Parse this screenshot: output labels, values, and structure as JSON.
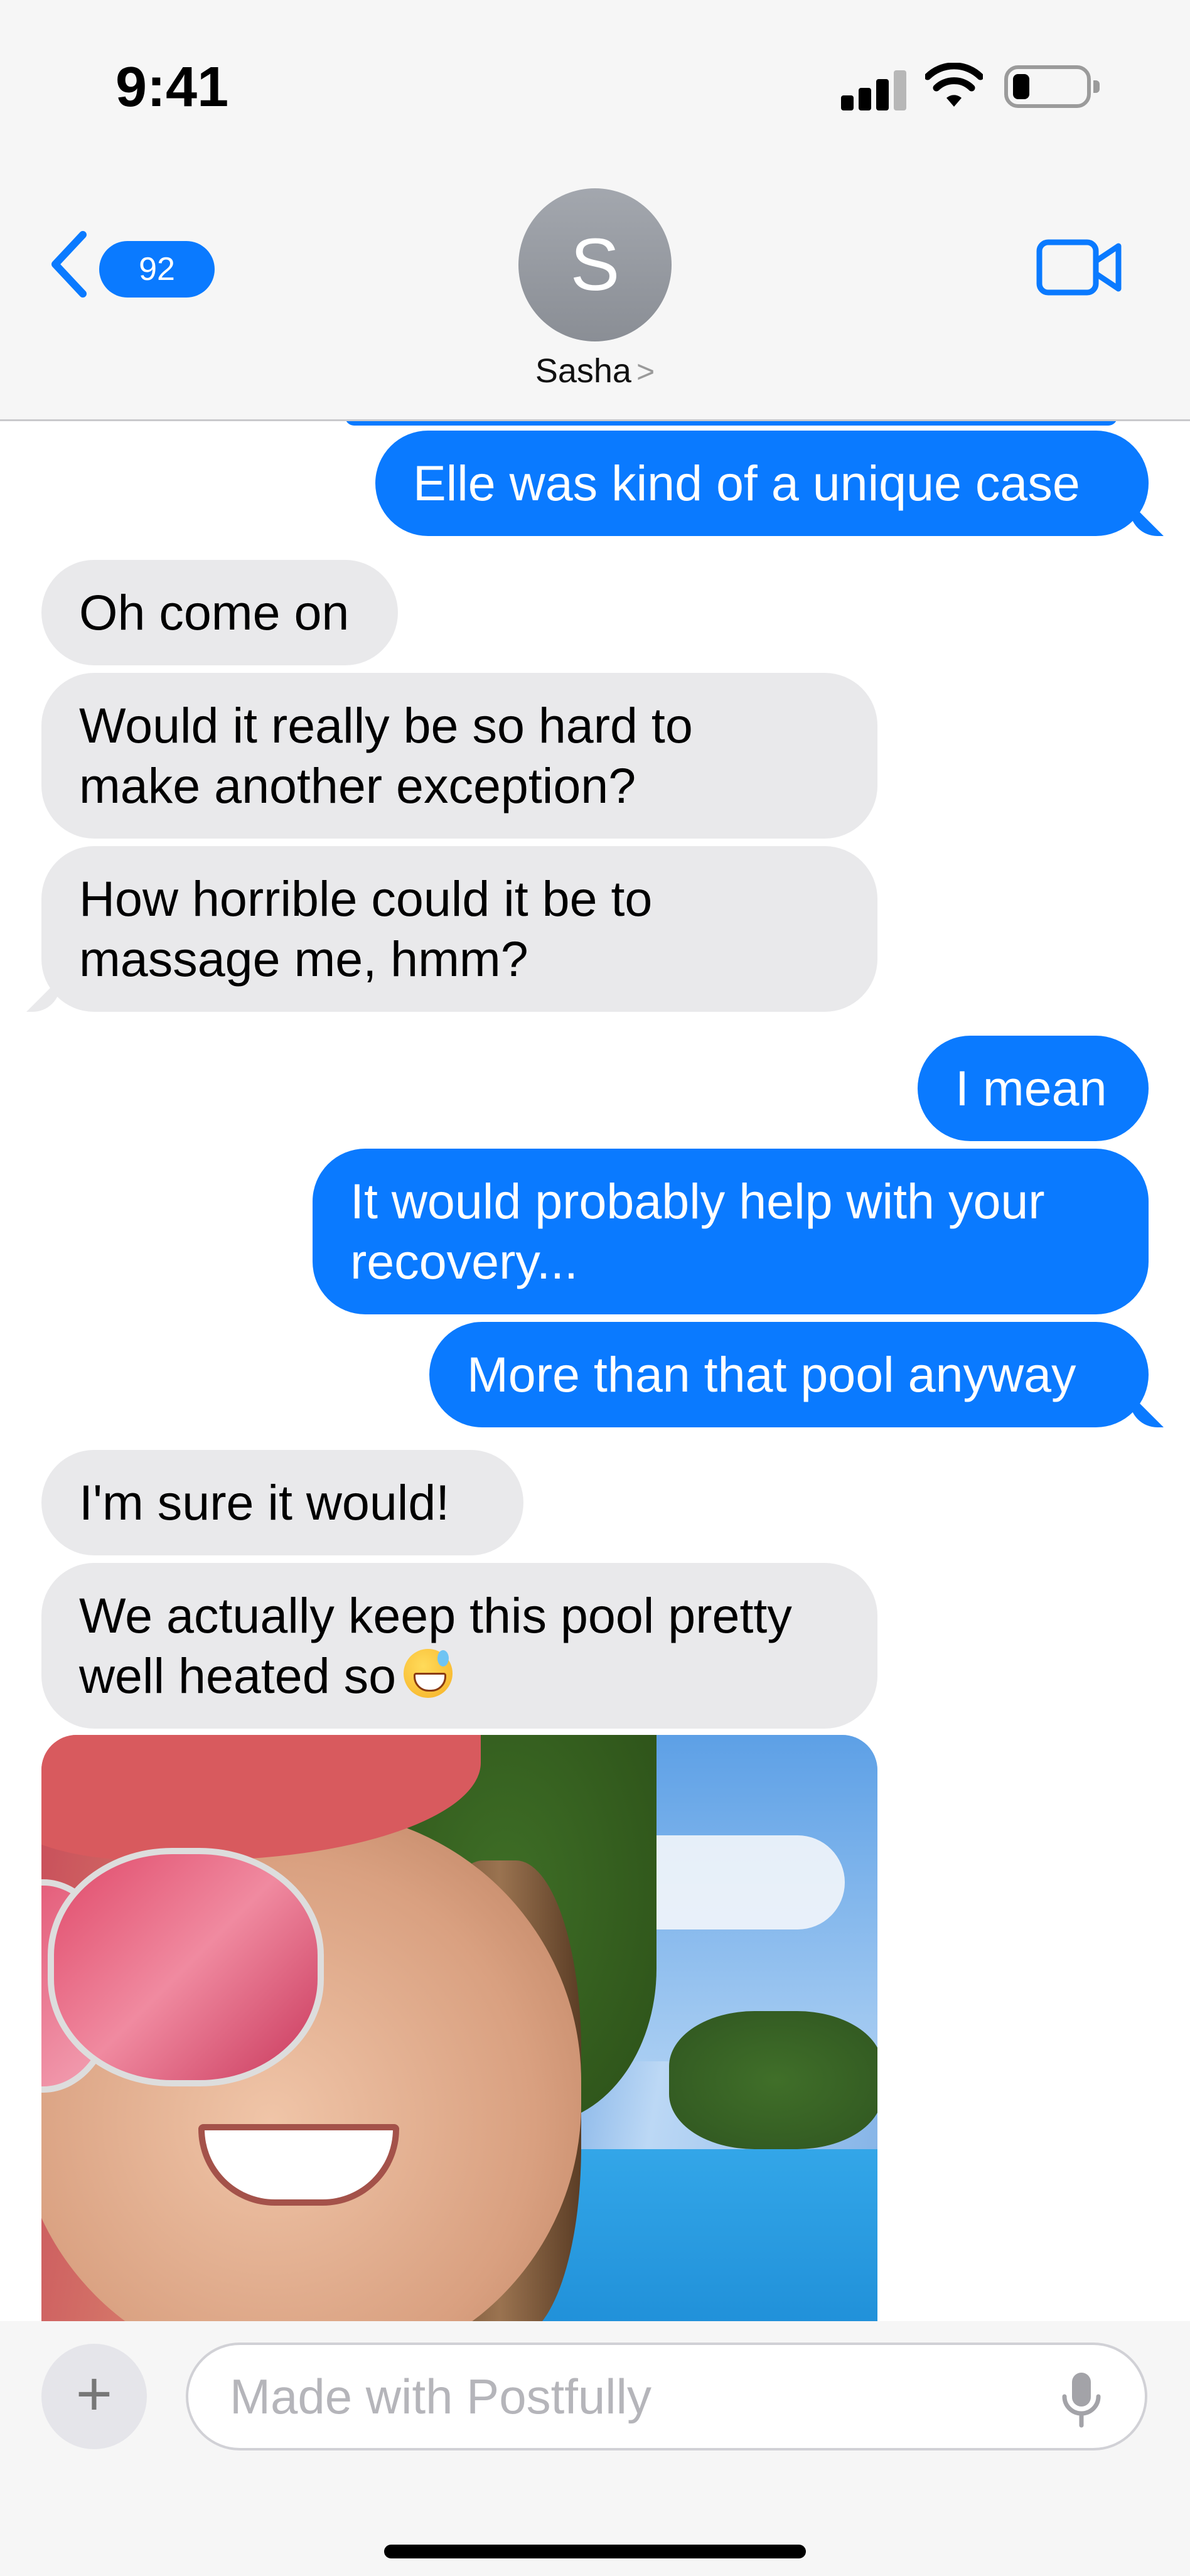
{
  "status_bar": {
    "time": "9:41"
  },
  "header": {
    "back_badge": "92",
    "avatar_initial": "S",
    "contact_name": "Sasha",
    "contact_chevron": ">"
  },
  "messages": [
    {
      "from": "me",
      "text": "Elle was kind of a unique case"
    },
    {
      "from": "them",
      "text": "Oh come on"
    },
    {
      "from": "them",
      "line1": "Would it really be so hard to",
      "line2": "make another exception?"
    },
    {
      "from": "them",
      "line1": "How horrible could it be to",
      "line2": "massage me, hmm?"
    },
    {
      "from": "me",
      "text": "I mean"
    },
    {
      "from": "me",
      "line1": "It would probably help with your",
      "line2": "recovery..."
    },
    {
      "from": "me",
      "text": "More than that pool anyway"
    },
    {
      "from": "them",
      "text": "I'm sure it would!"
    },
    {
      "from": "them",
      "line1": "We actually keep this pool pretty",
      "line2": "well heated so",
      "emoji": "sweat-smile-emoji"
    }
  ],
  "input_bar": {
    "plus_label": "+",
    "placeholder": "Made with Postfully"
  },
  "icons": {
    "back": "chevron-left-icon",
    "video": "video-camera-icon",
    "mic": "microphone-icon",
    "signal": "cellular-signal-icon",
    "wifi": "wifi-icon",
    "battery": "battery-icon"
  },
  "colors": {
    "accent": "#0a7aff",
    "incoming_bubble": "#e9e9eb",
    "header_bg": "#f6f6f6"
  }
}
